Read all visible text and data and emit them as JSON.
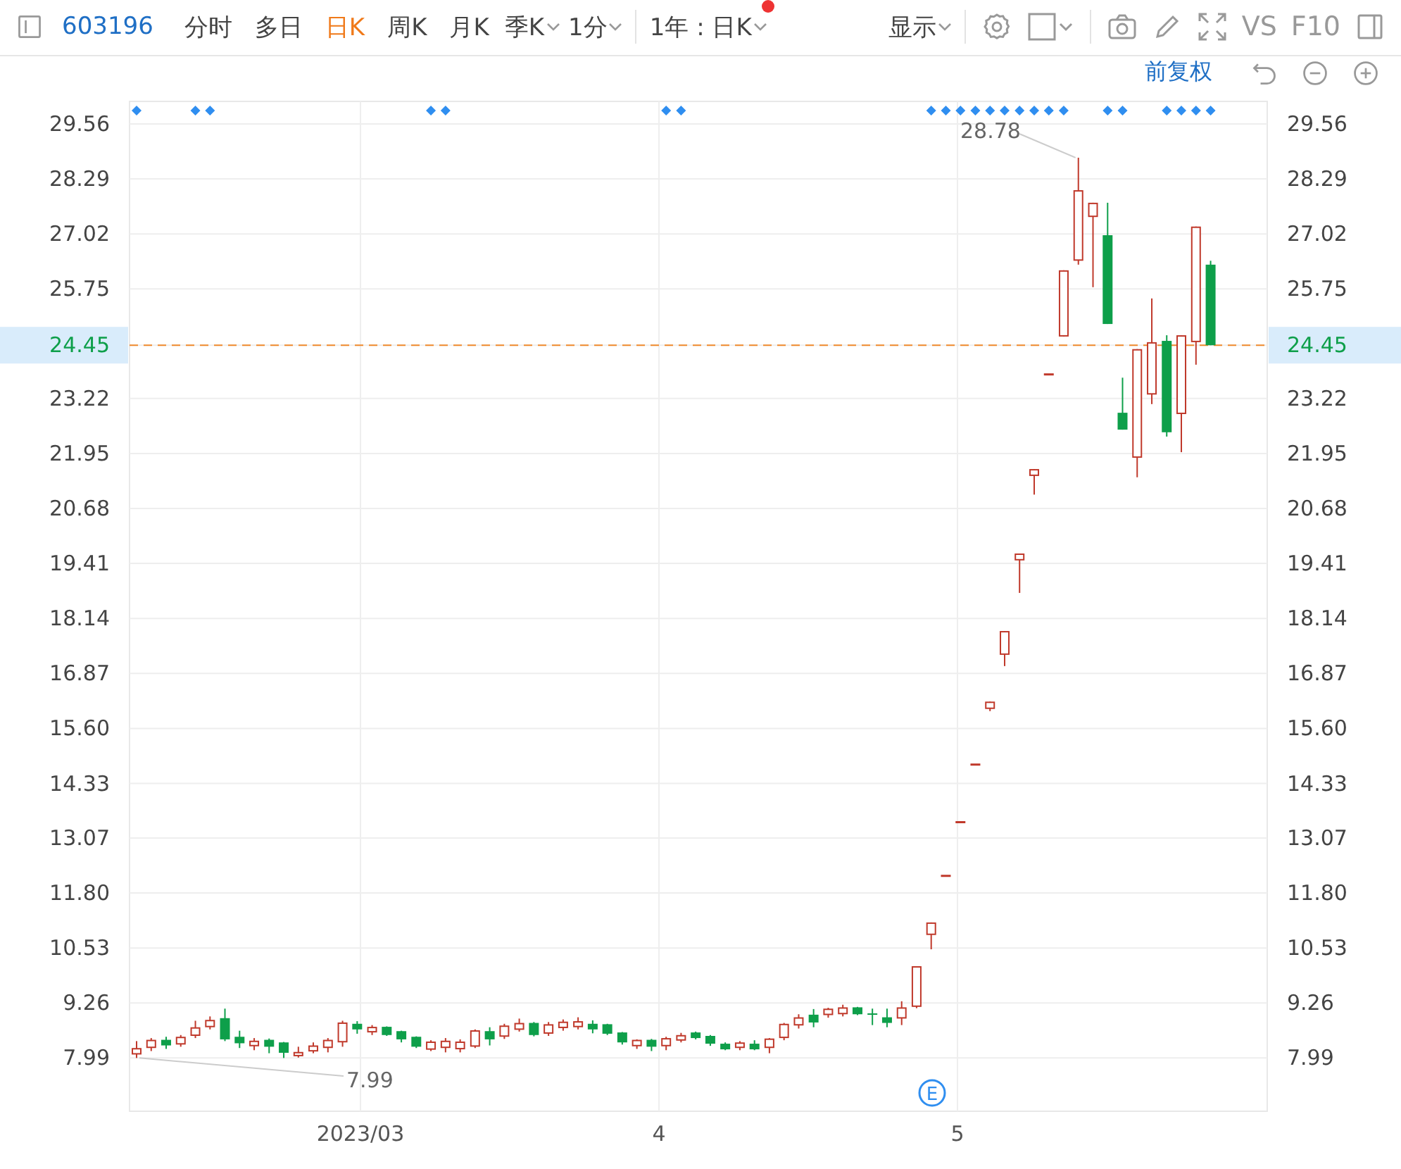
{
  "toolbar": {
    "code": "603196",
    "tabs": [
      {
        "label": "分时",
        "selected": false
      },
      {
        "label": "多日",
        "selected": false
      },
      {
        "label": "日K",
        "selected": true
      },
      {
        "label": "周K",
        "selected": false
      },
      {
        "label": "月K",
        "selected": false
      }
    ],
    "dropdowns": [
      {
        "label": "季K"
      },
      {
        "label": "1分"
      }
    ],
    "range": {
      "label": "1年 : 日K",
      "notice": true
    },
    "display": {
      "label": "显示"
    },
    "compare": "VS",
    "f10": "F10"
  },
  "subbar": {
    "adjust": "前复权"
  },
  "chart": {
    "max_label": "28.78",
    "min_label": "7.99",
    "event_label": "E",
    "right_axis_labels": [
      "29.56",
      "28.29",
      "27.02",
      "25.75",
      "24.45",
      "23.22",
      "21.95",
      "20.68",
      "19.41",
      "18.14",
      "16.87",
      "15.60",
      "14.33",
      "13.07",
      "11.80",
      "10.53",
      "9.26",
      "7.99"
    ],
    "event_marks": [
      true,
      false,
      false,
      false,
      true,
      true,
      false,
      false,
      false,
      false,
      false,
      false,
      false,
      false,
      false,
      false,
      false,
      false,
      false,
      false,
      true,
      true,
      false,
      false,
      false,
      false,
      false,
      false,
      false,
      false,
      false,
      false,
      false,
      false,
      false,
      false,
      true,
      true,
      false,
      false,
      false,
      false,
      false,
      false,
      false,
      false,
      false,
      false,
      false,
      false,
      false,
      false,
      false,
      false,
      true,
      true,
      true,
      true,
      true,
      true,
      true,
      true,
      true,
      true,
      false,
      false,
      true,
      true,
      false,
      false,
      true,
      true,
      true,
      true
    ],
    "chart_data": {
      "type": "candlestick",
      "x": [
        2.25,
        2.299,
        2.349,
        2.398,
        2.447,
        2.496,
        2.546,
        2.595,
        2.644,
        2.694,
        2.743,
        2.792,
        2.842,
        2.891,
        2.94,
        2.989,
        3.039,
        3.088,
        3.137,
        3.187,
        3.236,
        3.285,
        3.334,
        3.384,
        3.433,
        3.482,
        3.532,
        3.581,
        3.63,
        3.679,
        3.729,
        3.778,
        3.827,
        3.877,
        3.926,
        3.975,
        4.024,
        4.074,
        4.123,
        4.172,
        4.222,
        4.271,
        4.32,
        4.37,
        4.419,
        4.468,
        4.518,
        4.567,
        4.616,
        4.665,
        4.715,
        4.764,
        4.813,
        4.863,
        4.912,
        4.961,
        5.01,
        5.06,
        5.109,
        5.158,
        5.208,
        5.257,
        5.306,
        5.356,
        5.405,
        5.454,
        5.503,
        5.553,
        5.602,
        5.651,
        5.701,
        5.75,
        5.799,
        5.848
      ],
      "ohlc": [
        [
          8.07,
          8.38,
          7.99,
          8.22
        ],
        [
          8.22,
          8.45,
          8.15,
          8.41
        ],
        [
          8.41,
          8.48,
          8.2,
          8.28
        ],
        [
          8.3,
          8.52,
          8.25,
          8.48
        ],
        [
          8.5,
          8.85,
          8.45,
          8.7
        ],
        [
          8.7,
          8.95,
          8.65,
          8.87
        ],
        [
          8.91,
          9.13,
          8.38,
          8.42
        ],
        [
          8.48,
          8.62,
          8.22,
          8.33
        ],
        [
          8.26,
          8.45,
          8.17,
          8.39
        ],
        [
          8.41,
          8.44,
          8.1,
          8.25
        ],
        [
          8.35,
          8.36,
          7.99,
          8.11
        ],
        [
          8.03,
          8.25,
          8.0,
          8.13
        ],
        [
          8.14,
          8.35,
          8.1,
          8.28
        ],
        [
          8.22,
          8.45,
          8.12,
          8.41
        ],
        [
          8.35,
          8.85,
          8.25,
          8.81
        ],
        [
          8.78,
          8.84,
          8.55,
          8.65
        ],
        [
          8.58,
          8.75,
          8.52,
          8.71
        ],
        [
          8.71,
          8.72,
          8.5,
          8.52
        ],
        [
          8.61,
          8.62,
          8.35,
          8.42
        ],
        [
          8.48,
          8.49,
          8.22,
          8.25
        ],
        [
          8.18,
          8.4,
          8.15,
          8.37
        ],
        [
          8.22,
          8.45,
          8.12,
          8.39
        ],
        [
          8.19,
          8.42,
          8.12,
          8.37
        ],
        [
          8.25,
          8.65,
          8.22,
          8.63
        ],
        [
          8.61,
          8.7,
          8.28,
          8.42
        ],
        [
          8.48,
          8.78,
          8.43,
          8.74
        ],
        [
          8.64,
          8.9,
          8.6,
          8.8
        ],
        [
          8.8,
          8.82,
          8.49,
          8.52
        ],
        [
          8.55,
          8.82,
          8.5,
          8.77
        ],
        [
          8.68,
          8.88,
          8.62,
          8.83
        ],
        [
          8.7,
          8.93,
          8.65,
          8.84
        ],
        [
          8.78,
          8.86,
          8.56,
          8.65
        ],
        [
          8.77,
          8.78,
          8.52,
          8.55
        ],
        [
          8.58,
          8.59,
          8.3,
          8.35
        ],
        [
          8.26,
          8.42,
          8.2,
          8.41
        ],
        [
          8.41,
          8.43,
          8.15,
          8.25
        ],
        [
          8.26,
          8.48,
          8.17,
          8.45
        ],
        [
          8.39,
          8.57,
          8.35,
          8.52
        ],
        [
          8.58,
          8.6,
          8.42,
          8.45
        ],
        [
          8.5,
          8.52,
          8.27,
          8.32
        ],
        [
          8.32,
          8.35,
          8.17,
          8.19
        ],
        [
          8.22,
          8.38,
          8.17,
          8.35
        ],
        [
          8.32,
          8.4,
          8.17,
          8.19
        ],
        [
          8.22,
          8.45,
          8.1,
          8.44
        ],
        [
          8.45,
          8.8,
          8.4,
          8.78
        ],
        [
          8.74,
          9.0,
          8.67,
          8.93
        ],
        [
          8.99,
          9.12,
          8.7,
          8.81
        ],
        [
          8.98,
          9.15,
          8.92,
          9.13
        ],
        [
          9.0,
          9.22,
          8.95,
          9.16
        ],
        [
          9.16,
          9.17,
          8.98,
          9.0
        ],
        [
          9.02,
          9.13,
          8.75,
          9.0
        ],
        [
          8.93,
          9.13,
          8.7,
          8.8
        ],
        [
          8.9,
          9.3,
          8.75,
          9.16
        ],
        [
          9.17,
          10.11,
          9.14,
          10.11
        ],
        [
          10.83,
          11.12,
          10.5,
          11.12
        ],
        [
          12.22,
          12.22,
          12.22,
          12.22
        ],
        [
          13.46,
          13.46,
          13.46,
          13.46
        ],
        [
          14.79,
          14.79,
          14.79,
          14.79
        ],
        [
          16.05,
          16.22,
          16.0,
          16.22
        ],
        [
          17.3,
          17.85,
          17.04,
          17.85
        ],
        [
          19.48,
          19.64,
          18.73,
          19.64
        ],
        [
          21.43,
          21.59,
          21.0,
          21.59
        ],
        [
          23.8,
          23.8,
          23.8,
          23.8
        ],
        [
          24.65,
          26.18,
          24.65,
          26.18
        ],
        [
          26.4,
          28.78,
          26.31,
          28.03
        ],
        [
          27.41,
          27.74,
          25.79,
          27.74
        ],
        [
          26.99,
          27.74,
          24.94,
          24.94
        ],
        [
          22.89,
          23.7,
          22.5,
          22.5
        ],
        [
          21.85,
          24.36,
          21.4,
          24.36
        ],
        [
          23.31,
          25.53,
          23.09,
          24.52
        ],
        [
          24.55,
          24.68,
          22.34,
          22.44
        ],
        [
          22.86,
          24.68,
          21.98,
          24.68
        ],
        [
          24.52,
          27.19,
          24.0,
          27.19
        ],
        [
          26.31,
          26.4,
          24.45,
          24.45
        ]
      ],
      "grid": true,
      "xlim": [
        2.2264,
        6.0377
      ],
      "xticks": [
        {
          "value": 3,
          "label": "2023/03"
        },
        {
          "value": 4,
          "label": "4"
        },
        {
          "value": 5,
          "label": "5"
        }
      ],
      "ylim": [
        6.76,
        30.08
      ],
      "ref_lines": [
        {
          "axis": "y",
          "value": 24.45
        }
      ],
      "yticks": [
        {
          "value": 29.56,
          "label": "29.56"
        },
        {
          "value": 28.29,
          "label": "28.29"
        },
        {
          "value": 27.02,
          "label": "27.02"
        },
        {
          "value": 25.75,
          "label": "25.75"
        },
        {
          "value": 24.45,
          "label": "24.45"
        },
        {
          "value": 23.22,
          "label": "23.22"
        },
        {
          "value": 21.95,
          "label": "21.95"
        },
        {
          "value": 20.68,
          "label": "20.68"
        },
        {
          "value": 19.41,
          "label": "19.41"
        },
        {
          "value": 18.14,
          "label": "18.14"
        },
        {
          "value": 16.87,
          "label": "16.87"
        },
        {
          "value": 15.6,
          "label": "15.60"
        },
        {
          "value": 14.33,
          "label": "14.33"
        },
        {
          "value": 13.07,
          "label": "13.07"
        },
        {
          "value": 11.8,
          "label": "11.80"
        },
        {
          "value": 10.53,
          "label": "10.53"
        },
        {
          "value": 9.26,
          "label": "9.26"
        },
        {
          "value": 7.99,
          "label": "7.99"
        }
      ]
    }
  }
}
